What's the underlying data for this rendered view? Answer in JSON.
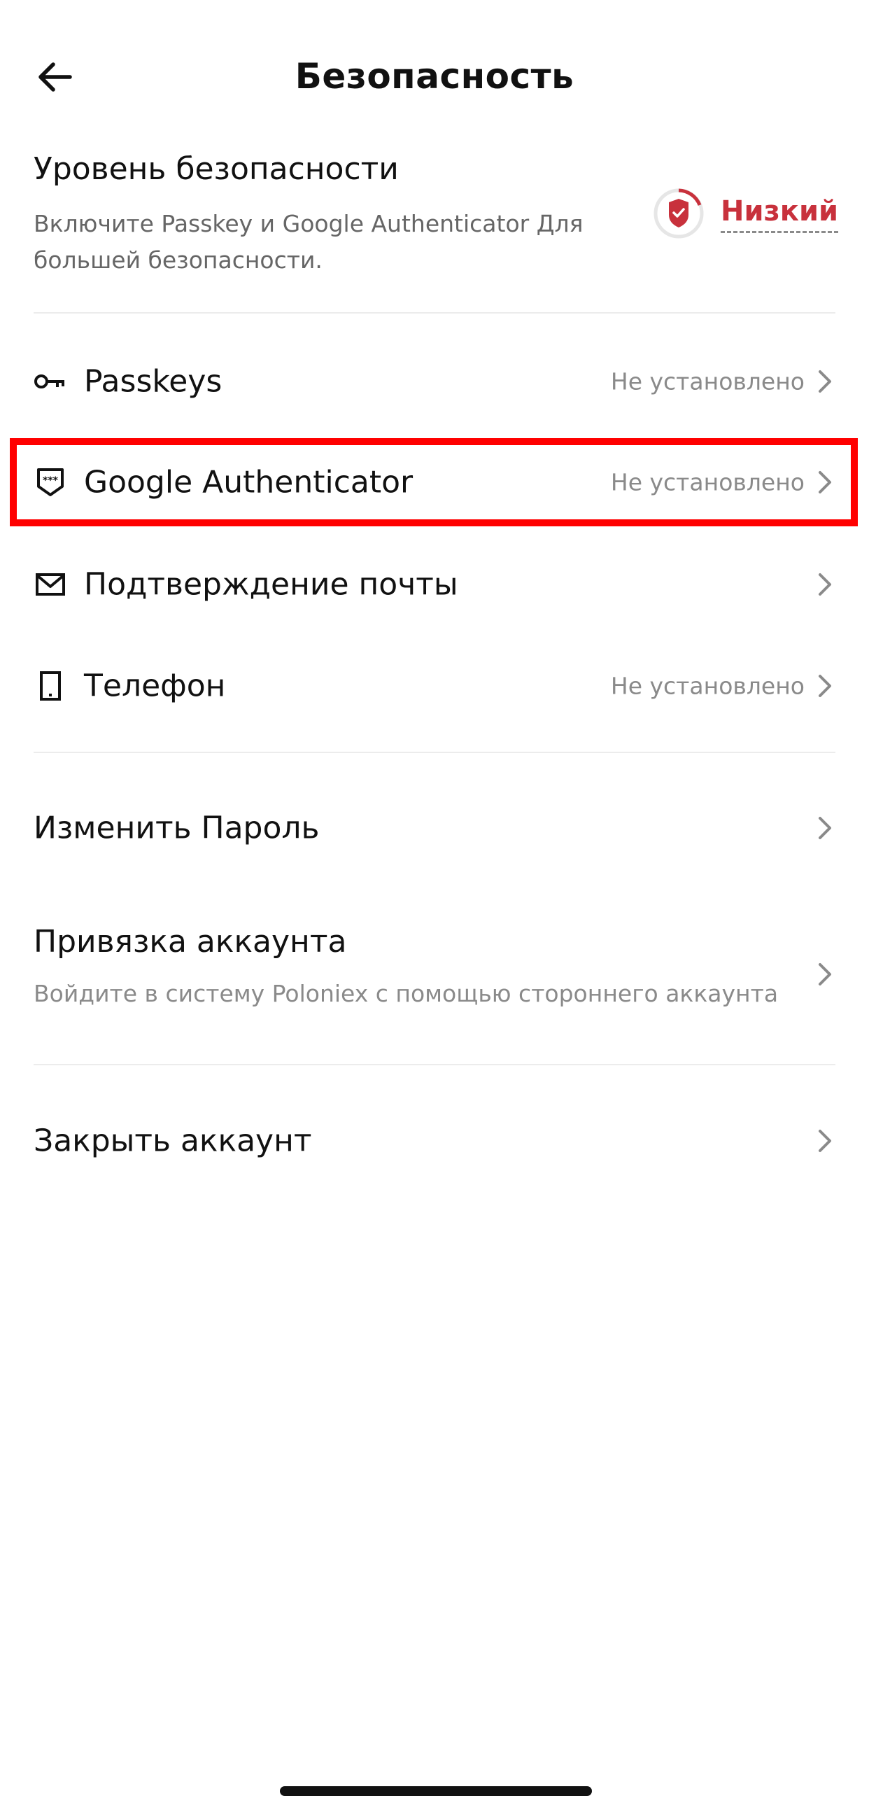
{
  "header": {
    "title": "Безопасность"
  },
  "security_level": {
    "title": "Уровень безопасности",
    "description": "Включите Passkey и Google Authenticator Для большей безопасности.",
    "status": "Низкий",
    "status_color": "#c8313c"
  },
  "methods": [
    {
      "label": "Passkeys",
      "value": "Не установлено",
      "icon": "key-icon"
    },
    {
      "label": "Google Authenticator",
      "value": "Не установлено",
      "icon": "authenticator-shield-icon"
    },
    {
      "label": "Подтверждение почты",
      "value": "",
      "icon": "mail-icon"
    },
    {
      "label": "Телефон",
      "value": "Не установлено",
      "icon": "phone-icon"
    }
  ],
  "change_password": {
    "label": "Изменить Пароль"
  },
  "account_binding": {
    "title": "Привязка аккаунта",
    "description": "Войдите в систему Poloniex с помощью стороннего аккаунта"
  },
  "close_account": {
    "label": "Закрыть аккаунт"
  },
  "colors": {
    "highlight": "#ff0000",
    "accent_red": "#c8313c",
    "secondary_text": "#8a8a8a"
  }
}
